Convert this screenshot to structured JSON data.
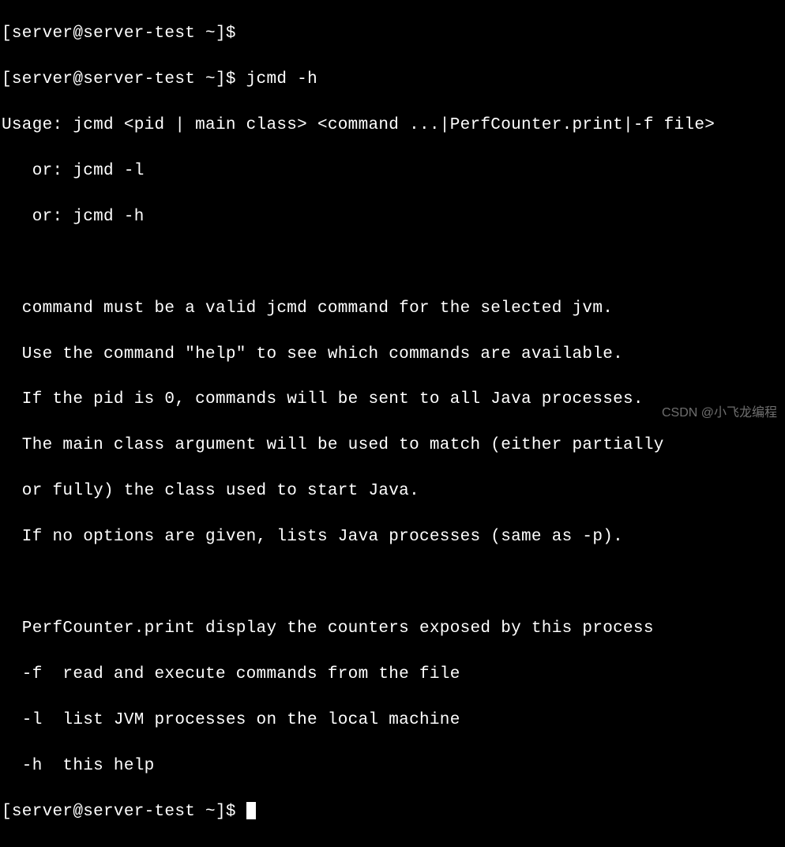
{
  "lines": {
    "l0": "[server@server-test ~]$ ",
    "l1_prompt": "[server@server-test ~]$ ",
    "l1_cmd": "jcmd -h",
    "l2": "Usage: jcmd <pid | main class> <command ...|PerfCounter.print|-f file>",
    "l3": "   or: jcmd -l",
    "l4": "   or: jcmd -h",
    "l5": "",
    "l6": "  command must be a valid jcmd command for the selected jvm.",
    "l7": "  Use the command \"help\" to see which commands are available.",
    "l8": "  If the pid is 0, commands will be sent to all Java processes.",
    "l9": "  The main class argument will be used to match (either partially",
    "l10": "  or fully) the class used to start Java.",
    "l11": "  If no options are given, lists Java processes (same as -p).",
    "l12": "",
    "l13": "  PerfCounter.print display the counters exposed by this process",
    "l14": "  -f  read and execute commands from the file",
    "l15": "  -l  list JVM processes on the local machine",
    "l16": "  -h  this help",
    "l17_prompt": "[server@server-test ~]$ "
  },
  "watermark": "CSDN @小飞龙编程"
}
